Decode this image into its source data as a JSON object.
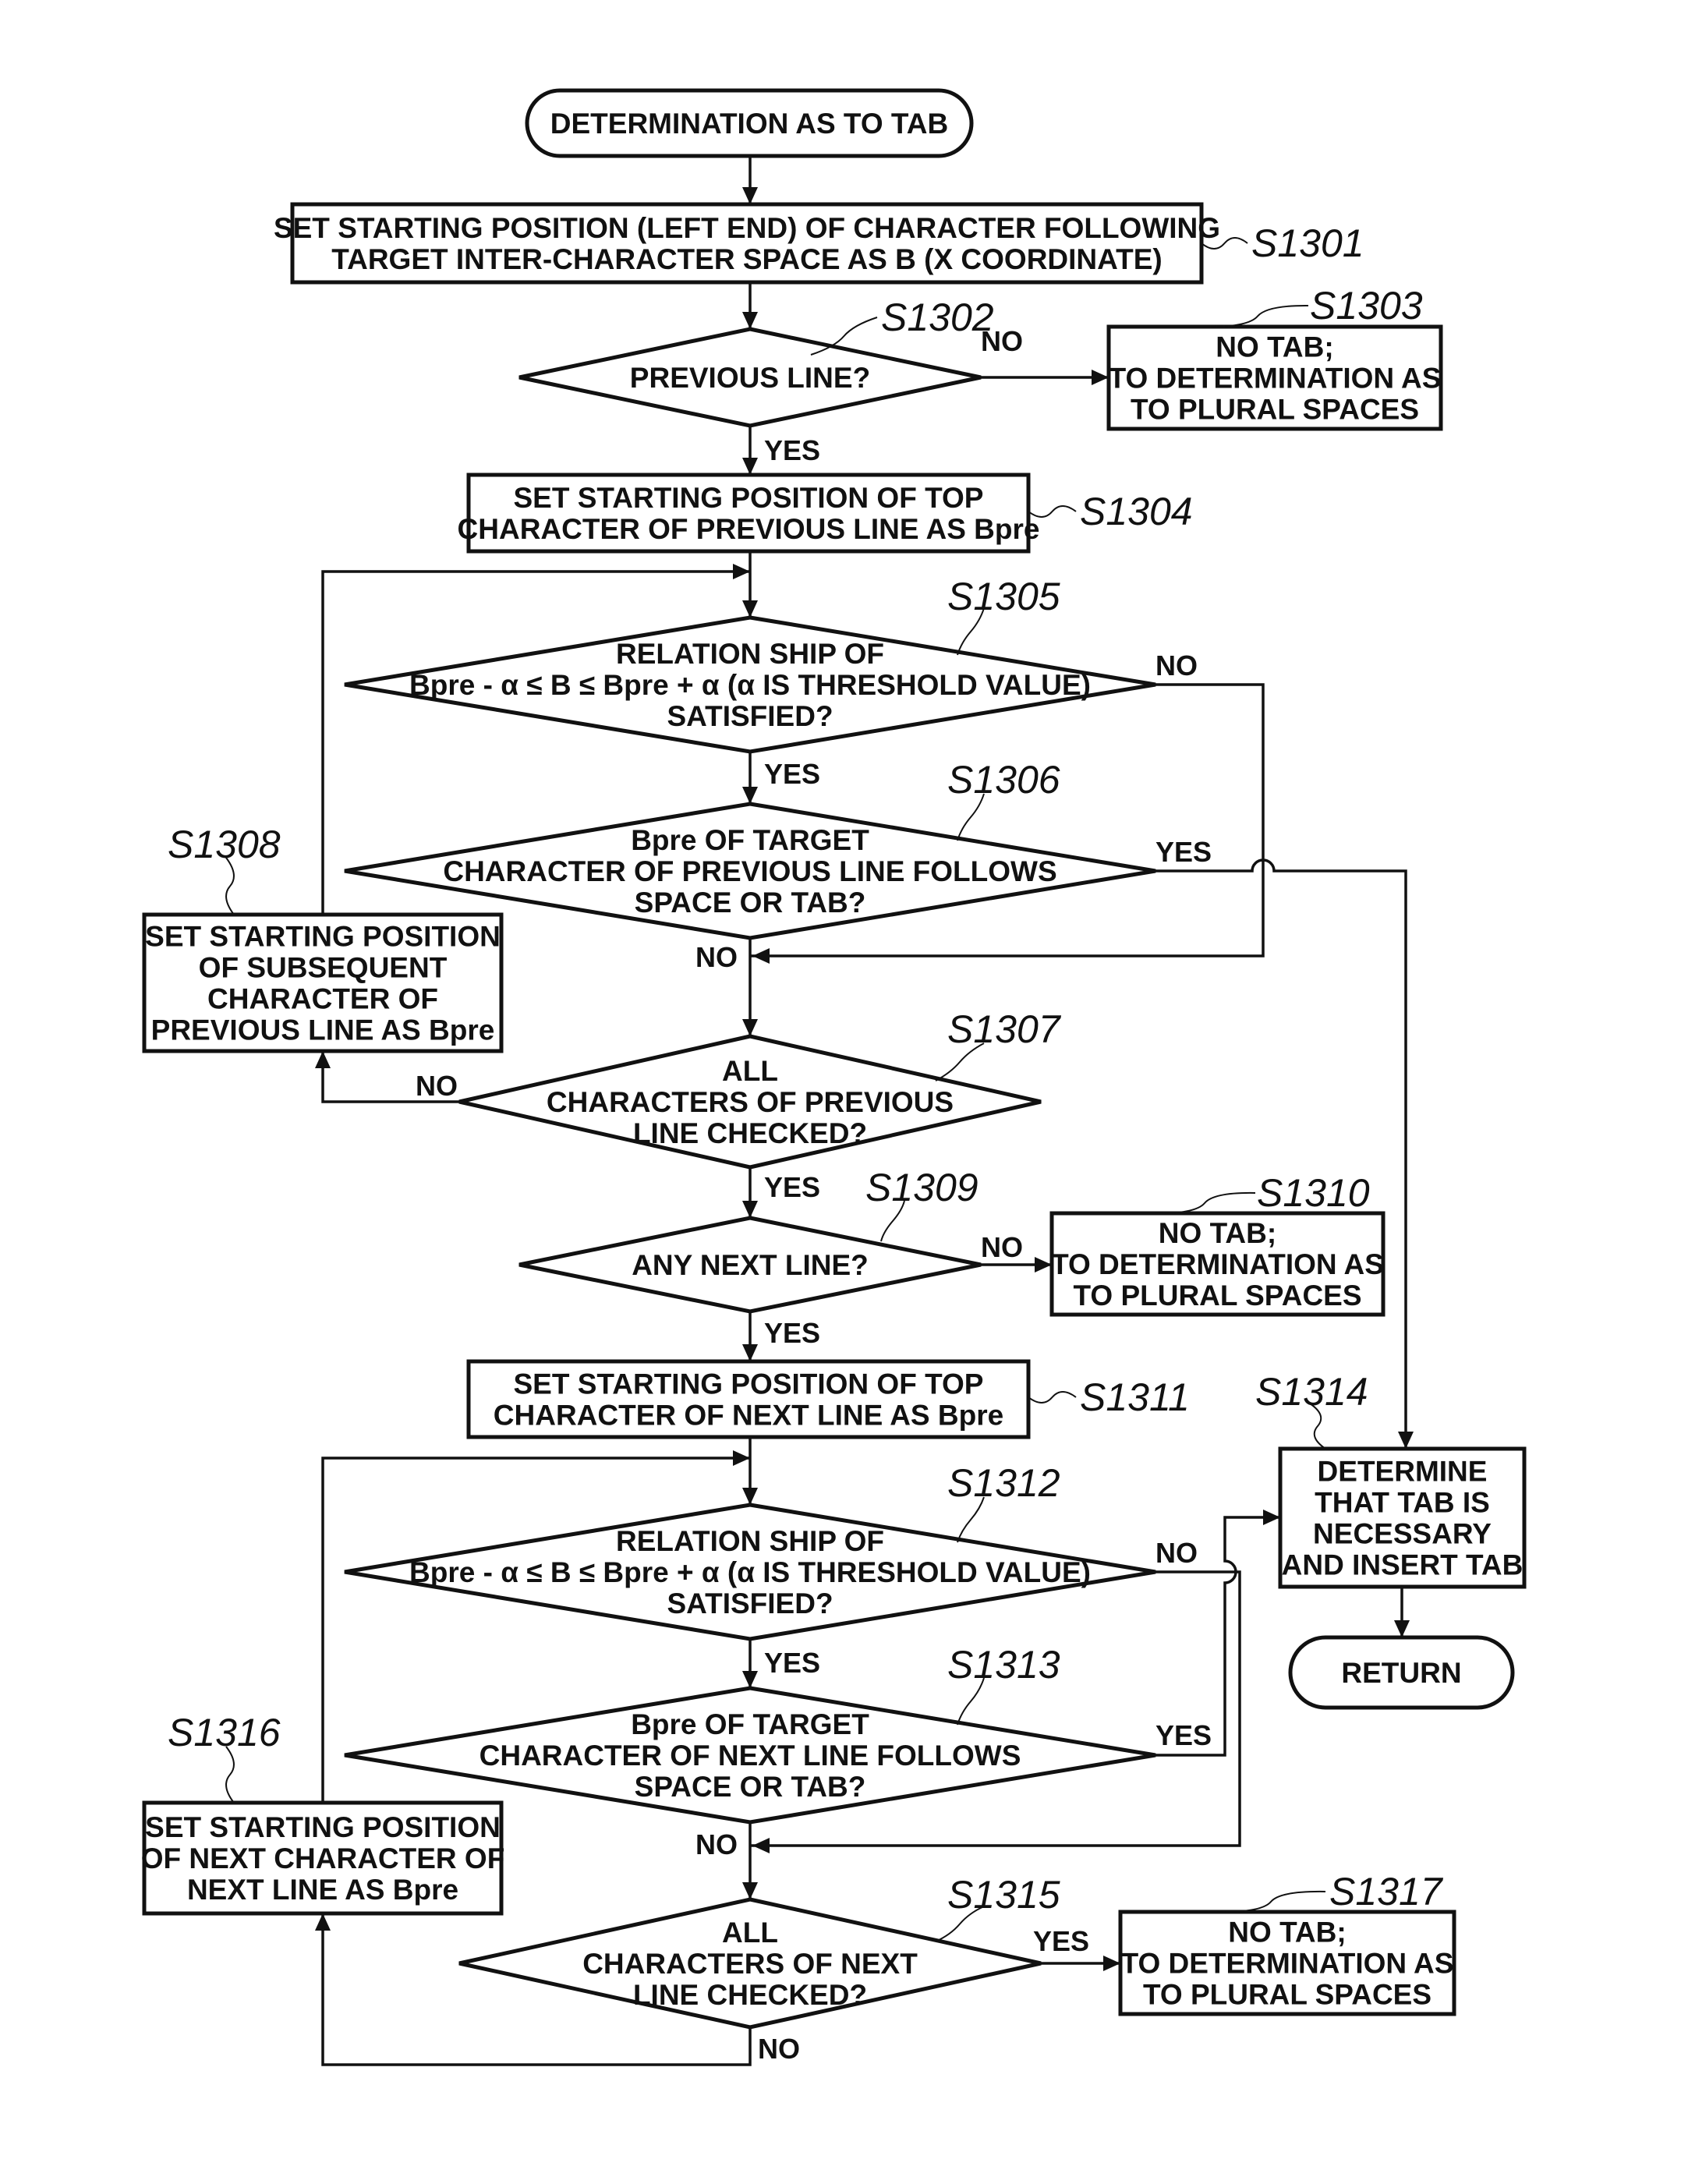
{
  "diagram": {
    "type": "flowchart",
    "colors": {
      "stroke": "#111111",
      "background": "#ffffff"
    },
    "nodes": [
      {
        "id": "start",
        "kind": "terminal",
        "lines": [
          "DETERMINATION AS TO TAB"
        ]
      },
      {
        "id": "S1301",
        "kind": "process",
        "step": "S1301",
        "lines": [
          "SET STARTING POSITION (LEFT END) OF CHARACTER FOLLOWING",
          "TARGET INTER-CHARACTER SPACE AS B (X COORDINATE)"
        ]
      },
      {
        "id": "S1302",
        "kind": "decision",
        "step": "S1302",
        "lines": [
          "PREVIOUS LINE?"
        ]
      },
      {
        "id": "S1303",
        "kind": "process",
        "step": "S1303",
        "lines": [
          "NO TAB;",
          "TO DETERMINATION AS",
          "TO PLURAL SPACES"
        ]
      },
      {
        "id": "S1304",
        "kind": "process",
        "step": "S1304",
        "lines": [
          "SET STARTING POSITION OF TOP",
          "CHARACTER OF PREVIOUS LINE AS Bpre"
        ]
      },
      {
        "id": "S1305",
        "kind": "decision",
        "step": "S1305",
        "lines": [
          "RELATION SHIP OF",
          "Bpre - α ≤ B ≤ Bpre + α (α IS THRESHOLD VALUE)",
          "SATISFIED?"
        ]
      },
      {
        "id": "S1306",
        "kind": "decision",
        "step": "S1306",
        "lines": [
          "Bpre OF TARGET",
          "CHARACTER OF PREVIOUS LINE FOLLOWS",
          "SPACE OR TAB?"
        ]
      },
      {
        "id": "S1307",
        "kind": "decision",
        "step": "S1307",
        "lines": [
          "ALL",
          "CHARACTERS OF PREVIOUS",
          "LINE CHECKED?"
        ]
      },
      {
        "id": "S1308",
        "kind": "process",
        "step": "S1308",
        "lines": [
          "SET STARTING POSITION",
          "OF SUBSEQUENT",
          "CHARACTER OF",
          "PREVIOUS LINE AS Bpre"
        ]
      },
      {
        "id": "S1309",
        "kind": "decision",
        "step": "S1309",
        "lines": [
          "ANY NEXT LINE?"
        ]
      },
      {
        "id": "S1310",
        "kind": "process",
        "step": "S1310",
        "lines": [
          "NO TAB;",
          "TO DETERMINATION AS",
          "TO PLURAL SPACES"
        ]
      },
      {
        "id": "S1311",
        "kind": "process",
        "step": "S1311",
        "lines": [
          "SET STARTING POSITION OF TOP",
          "CHARACTER OF NEXT LINE AS Bpre"
        ]
      },
      {
        "id": "S1312",
        "kind": "decision",
        "step": "S1312",
        "lines": [
          "RELATION SHIP OF",
          "Bpre - α ≤ B ≤ Bpre + α (α IS THRESHOLD VALUE)",
          "SATISFIED?"
        ]
      },
      {
        "id": "S1313",
        "kind": "decision",
        "step": "S1313",
        "lines": [
          "Bpre OF TARGET",
          "CHARACTER OF NEXT LINE FOLLOWS",
          "SPACE OR TAB?"
        ]
      },
      {
        "id": "S1314",
        "kind": "process",
        "step": "S1314",
        "lines": [
          "DETERMINE",
          "THAT TAB IS",
          "NECESSARY",
          "AND INSERT TAB"
        ]
      },
      {
        "id": "return",
        "kind": "terminal",
        "lines": [
          "RETURN"
        ]
      },
      {
        "id": "S1315",
        "kind": "decision",
        "step": "S1315",
        "lines": [
          "ALL",
          "CHARACTERS OF NEXT",
          "LINE CHECKED?"
        ]
      },
      {
        "id": "S1316",
        "kind": "process",
        "step": "S1316",
        "lines": [
          "SET STARTING POSITION",
          "OF NEXT CHARACTER OF",
          "NEXT LINE AS Bpre"
        ]
      },
      {
        "id": "S1317",
        "kind": "process",
        "step": "S1317",
        "lines": [
          "NO TAB;",
          "TO DETERMINATION AS",
          "TO PLURAL SPACES"
        ]
      }
    ],
    "edges": [
      {
        "from": "start",
        "to": "S1301",
        "label": ""
      },
      {
        "from": "S1301",
        "to": "S1302",
        "label": ""
      },
      {
        "from": "S1302",
        "to": "S1303",
        "label": "NO"
      },
      {
        "from": "S1302",
        "to": "S1304",
        "label": "YES"
      },
      {
        "from": "S1304",
        "to": "S1305",
        "label": ""
      },
      {
        "from": "S1305",
        "to": "S1306",
        "label": "YES"
      },
      {
        "from": "S1305",
        "to": "S1307",
        "label": "NO"
      },
      {
        "from": "S1306",
        "to": "S1314",
        "label": "YES"
      },
      {
        "from": "S1306",
        "to": "S1307",
        "label": "NO"
      },
      {
        "from": "S1307",
        "to": "S1308",
        "label": "NO"
      },
      {
        "from": "S1308",
        "to": "S1305",
        "label": ""
      },
      {
        "from": "S1307",
        "to": "S1309",
        "label": "YES"
      },
      {
        "from": "S1309",
        "to": "S1310",
        "label": "NO"
      },
      {
        "from": "S1309",
        "to": "S1311",
        "label": "YES"
      },
      {
        "from": "S1311",
        "to": "S1312",
        "label": ""
      },
      {
        "from": "S1312",
        "to": "S1313",
        "label": "YES"
      },
      {
        "from": "S1312",
        "to": "S1315",
        "label": "NO"
      },
      {
        "from": "S1313",
        "to": "S1314",
        "label": "YES"
      },
      {
        "from": "S1313",
        "to": "S1315",
        "label": "NO"
      },
      {
        "from": "S1315",
        "to": "S1317",
        "label": "YES"
      },
      {
        "from": "S1315",
        "to": "S1316",
        "label": "NO"
      },
      {
        "from": "S1316",
        "to": "S1312",
        "label": ""
      },
      {
        "from": "S1314",
        "to": "return",
        "label": ""
      }
    ]
  }
}
